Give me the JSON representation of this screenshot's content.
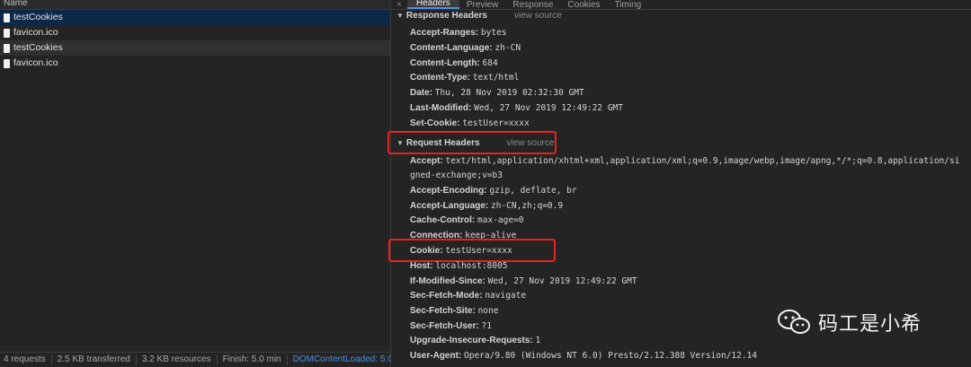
{
  "request_list": {
    "column_header": "Name",
    "rows": [
      {
        "name": "testCookies"
      },
      {
        "name": "favicon.ico"
      },
      {
        "name": "testCookies"
      },
      {
        "name": "favicon.ico"
      }
    ],
    "status": {
      "requests": "4 requests",
      "transferred": "2.5 KB transferred",
      "resources": "3.2 KB resources",
      "finish": "Finish: 5.0 min",
      "dom": "DOMContentLoaded: 5.0"
    }
  },
  "tabs": {
    "close": "×",
    "items": [
      "Headers",
      "Preview",
      "Response",
      "Cookies",
      "Timing"
    ]
  },
  "response_headers": {
    "title": "Response Headers",
    "view_source": "view source",
    "items": [
      {
        "key": "Accept-Ranges:",
        "value": "bytes"
      },
      {
        "key": "Content-Language:",
        "value": "zh-CN"
      },
      {
        "key": "Content-Length:",
        "value": "684"
      },
      {
        "key": "Content-Type:",
        "value": "text/html"
      },
      {
        "key": "Date:",
        "value": "Thu, 28 Nov 2019 02:32:30 GMT"
      },
      {
        "key": "Last-Modified:",
        "value": "Wed, 27 Nov 2019 12:49:22 GMT"
      },
      {
        "key": "Set-Cookie:",
        "value": "testUser=xxxx"
      }
    ]
  },
  "request_headers": {
    "title": "Request Headers",
    "view_source": "view source",
    "accept_key": "Accept:",
    "accept_value": "text/html,application/xhtml+xml,application/xml;q=0.9,image/webp,image/apng,*/*;q=0.8,application/si",
    "accept_value_cont": "gned-exchange;v=b3",
    "items": [
      {
        "key": "Accept-Encoding:",
        "value": "gzip, deflate, br"
      },
      {
        "key": "Accept-Language:",
        "value": "zh-CN,zh;q=0.9"
      },
      {
        "key": "Cache-Control:",
        "value": "max-age=0"
      },
      {
        "key": "Connection:",
        "value": "keep-alive"
      },
      {
        "key": "Cookie:",
        "value": "testUser=xxxx"
      },
      {
        "key": "Host:",
        "value": "localhost:8005"
      },
      {
        "key": "If-Modified-Since:",
        "value": "Wed, 27 Nov 2019 12:49:22 GMT"
      },
      {
        "key": "Sec-Fetch-Mode:",
        "value": "navigate"
      },
      {
        "key": "Sec-Fetch-Site:",
        "value": "none"
      },
      {
        "key": "Sec-Fetch-User:",
        "value": "?1"
      },
      {
        "key": "Upgrade-Insecure-Requests:",
        "value": "1"
      },
      {
        "key": "User-Agent:",
        "value": "Opera/9.80 (Windows NT 6.0) Presto/2.12.388 Version/12.14"
      }
    ]
  },
  "watermark": {
    "text": "码工是小希",
    "icon": "wechat-icon"
  },
  "colors": {
    "highlight": "#e8221c",
    "selected_row": "#0c2849",
    "link_blue": "#4a90e2"
  }
}
